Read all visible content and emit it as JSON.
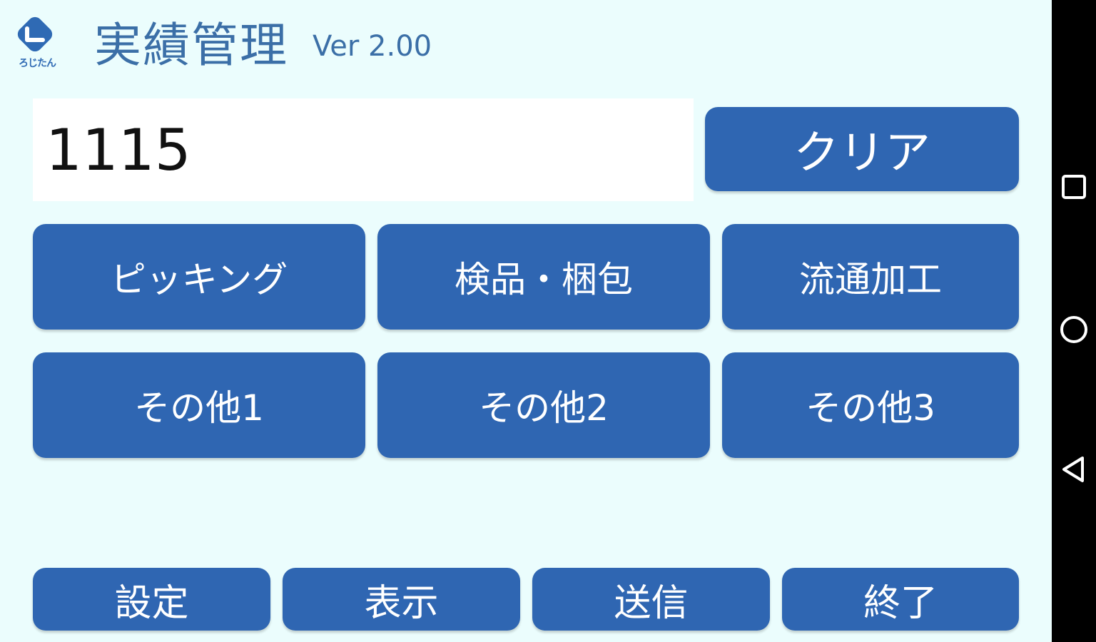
{
  "header": {
    "logo_caption": "ろじたん",
    "title": "実績管理",
    "version": "Ver 2.00"
  },
  "input": {
    "value": "1115"
  },
  "buttons": {
    "clear": "クリア",
    "grid": [
      "ピッキング",
      "検品・梱包",
      "流通加工",
      "その他1",
      "その他2",
      "その他3"
    ],
    "bottom": [
      "設定",
      "表示",
      "送信",
      "終了"
    ]
  },
  "colors": {
    "background": "#ebfdfd",
    "button": "#2f66b2",
    "title_text": "#3b6fa7",
    "navbar": "#000000"
  },
  "navbar": {
    "icons": [
      "recent-apps-icon",
      "home-icon",
      "back-icon"
    ]
  }
}
